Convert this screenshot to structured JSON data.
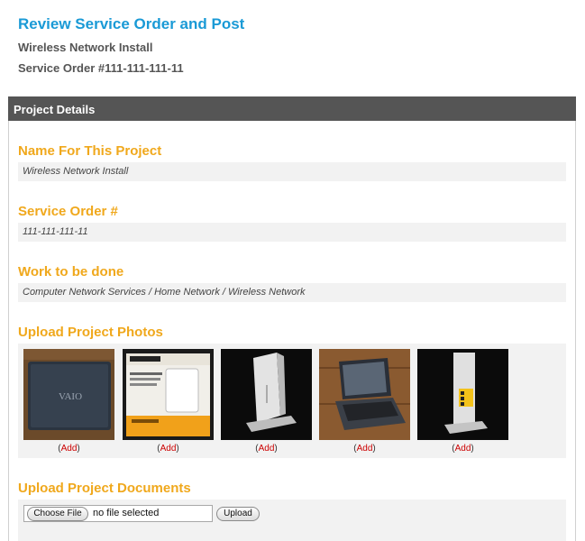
{
  "header": {
    "title": "Review Service Order and Post",
    "project_name": "Wireless Network Install",
    "service_order": "Service Order #111-111-111-11"
  },
  "panel": {
    "title": "Project Details",
    "fields": [
      {
        "label": "Name For This Project",
        "value": "Wireless Network Install"
      },
      {
        "label": "Service Order #",
        "value": "111-111-111-11"
      },
      {
        "label": "Work to be done",
        "value": "Computer Network Services / Home Network / Wireless Network"
      }
    ],
    "photos": {
      "label": "Upload Project Photos",
      "items": [
        {
          "subject": "vaio-laptop-photo",
          "add_label": "Add"
        },
        {
          "subject": "netgear-box-photo",
          "add_label": "Add"
        },
        {
          "subject": "router-standing-photo",
          "add_label": "Add"
        },
        {
          "subject": "open-laptop-photo",
          "add_label": "Add"
        },
        {
          "subject": "router-ports-photo",
          "add_label": "Add"
        }
      ]
    },
    "documents": {
      "label": "Upload Project Documents",
      "choose_label": "Choose File",
      "file_status": "no file selected",
      "upload_label": "Upload"
    }
  },
  "colors": {
    "title_blue": "#1a9ad6",
    "section_orange": "#f0a81c",
    "header_gray": "#555555",
    "link_red": "#cc0000"
  }
}
